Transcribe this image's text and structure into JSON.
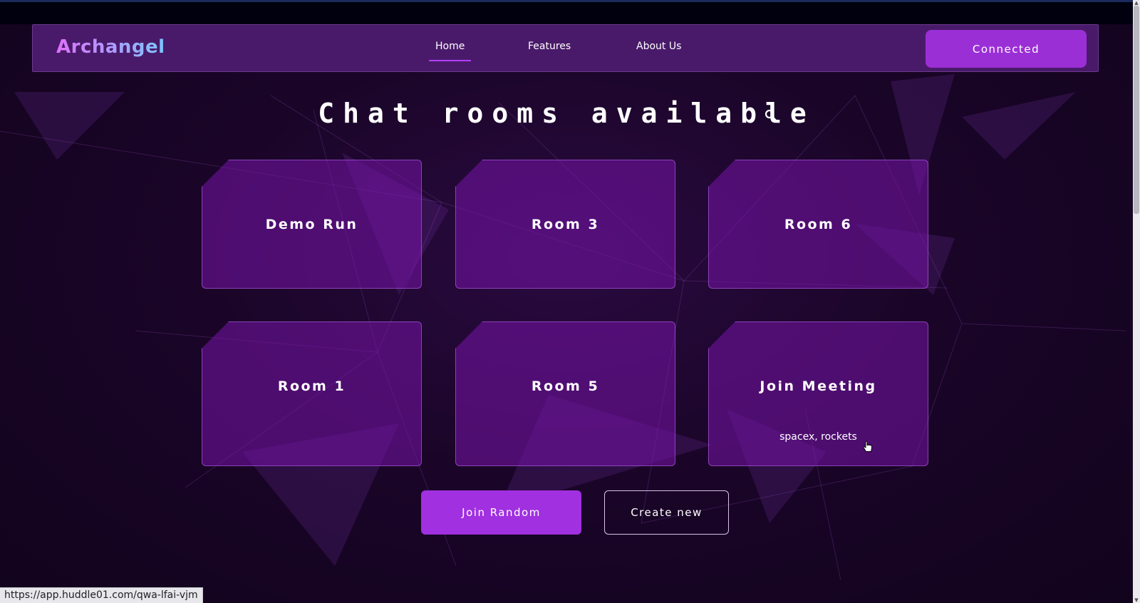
{
  "app": {
    "logo": "Archangel",
    "connected_label": "Connected"
  },
  "nav": {
    "items": [
      {
        "label": "Home",
        "active": true
      },
      {
        "label": "Features",
        "active": false
      },
      {
        "label": "About Us",
        "active": false
      }
    ]
  },
  "main": {
    "heading": "Chat rooms available",
    "rooms": [
      {
        "title": "Demo Run",
        "subtitle": ""
      },
      {
        "title": "Room 3",
        "subtitle": ""
      },
      {
        "title": "Room 6",
        "subtitle": ""
      },
      {
        "title": "Room 1",
        "subtitle": ""
      },
      {
        "title": "Room 5",
        "subtitle": ""
      },
      {
        "title": "Join Meeting",
        "subtitle": "spacex, rockets"
      }
    ],
    "join_random_label": "Join Random",
    "create_new_label": "Create new"
  },
  "status_bar": {
    "url": "https://app.huddle01.com/qwa-lfai-vjm"
  },
  "colors": {
    "accent": "#9b2fd6",
    "card_bg": "#6a1496",
    "background": "#1a0528"
  }
}
